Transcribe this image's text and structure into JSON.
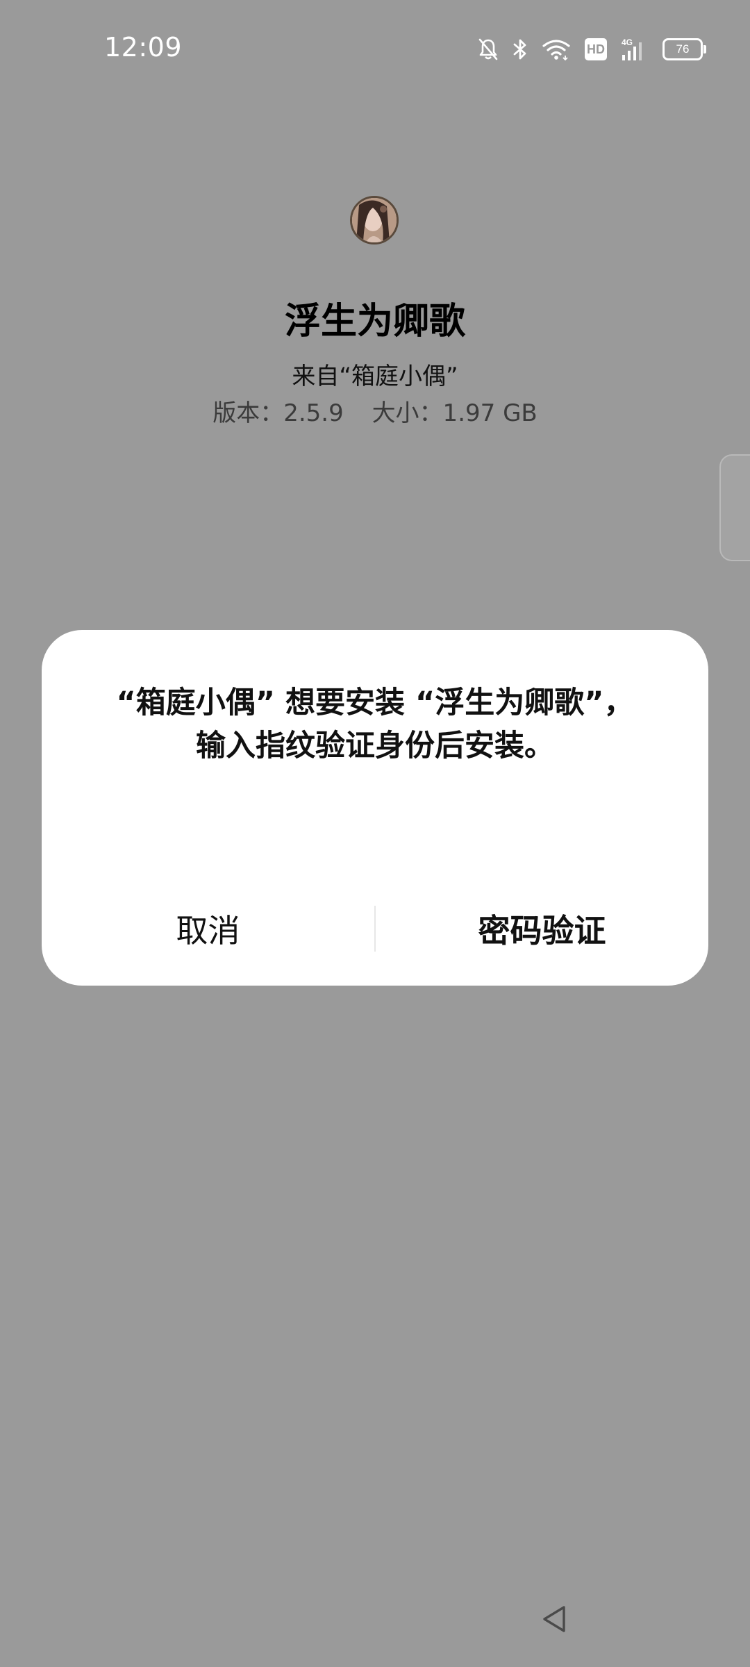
{
  "status_bar": {
    "time": "12:09",
    "network": "4G",
    "hd_label": "HD",
    "battery": "76",
    "icons": [
      "bell-off-icon",
      "bluetooth-icon",
      "wifi-icon",
      "hd-icon",
      "signal-icon",
      "battery-icon"
    ]
  },
  "app": {
    "name": "浮生为卿歌",
    "source": "来自“箱庭小偶”",
    "version_text": "版本：2.5.9",
    "size_text": "大小：1.97 GB"
  },
  "dialog": {
    "message_line1": "“箱庭小偶” 想要安装 “浮生为卿歌”，",
    "message_line2": "输入指纹验证身份后安装。",
    "cancel_label": "取消",
    "confirm_label": "密码验证"
  },
  "colors": {
    "overlay_background": "#9a9a9a",
    "dialog_background": "#ffffff",
    "text_primary": "#111111"
  }
}
